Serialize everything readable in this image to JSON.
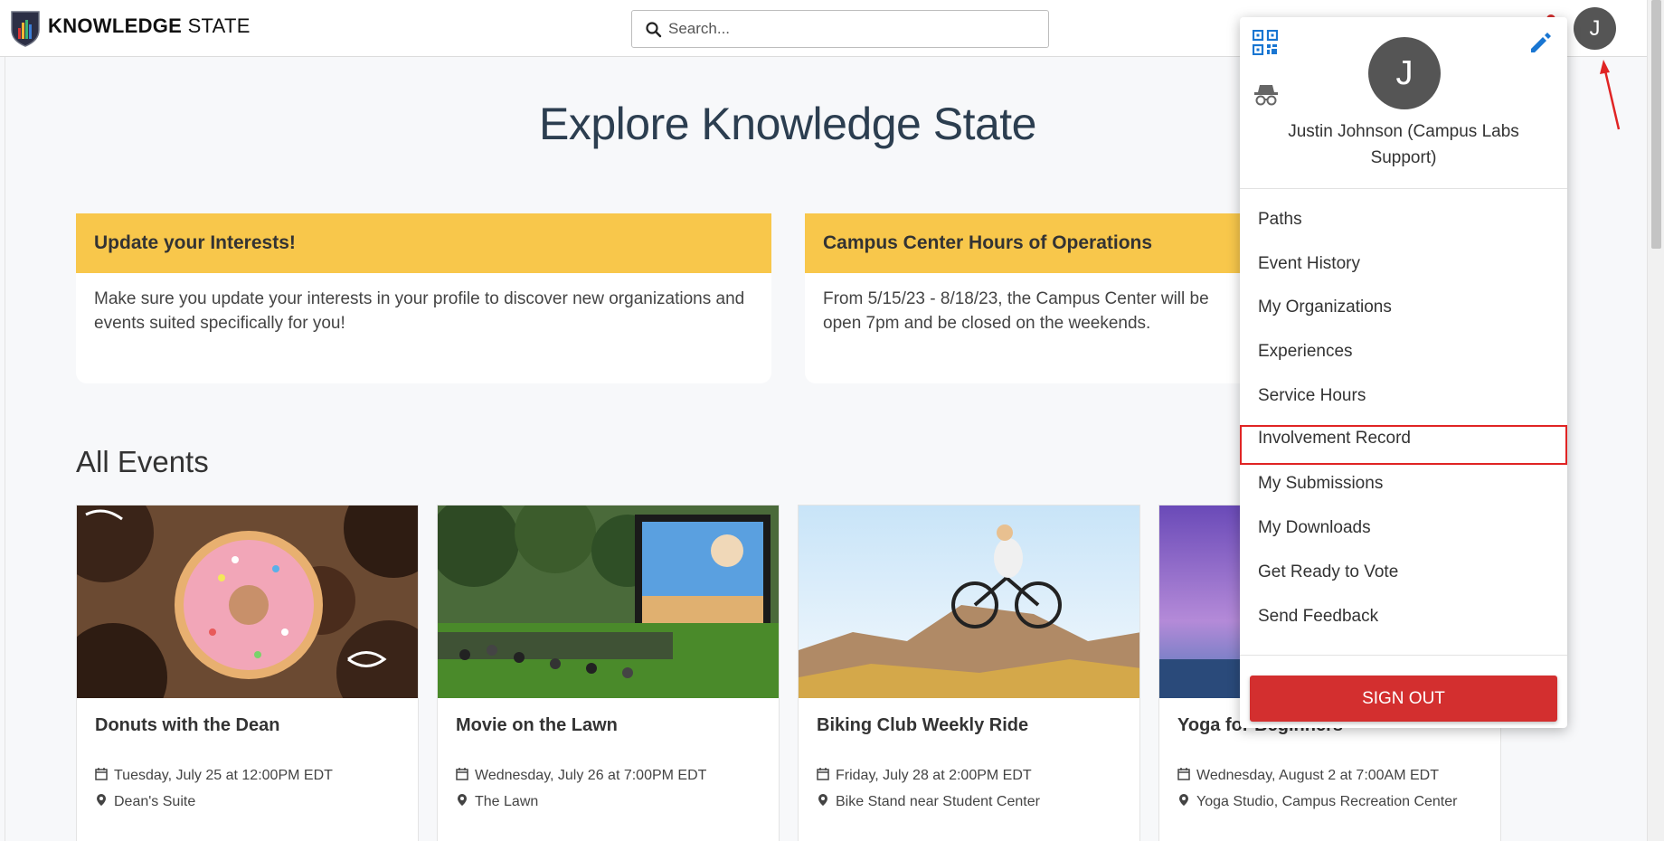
{
  "header": {
    "brand_bold": "KNOWLEDGE",
    "brand_light": "STATE",
    "search_placeholder": "Search...",
    "avatar_initial": "J"
  },
  "page": {
    "title": "Explore Knowledge State"
  },
  "announcements": [
    {
      "title": "Update your Interests!",
      "body": "Make sure you update your interests in your profile to discover new organizations and events suited specifically for you!"
    },
    {
      "title": "Campus Center Hours of Operations",
      "body": "From 5/15/23 - 8/18/23, the Campus Center will be open 7pm and be closed on the weekends."
    }
  ],
  "events_section": {
    "title": "All Events",
    "items": [
      {
        "title": "Donuts with the Dean",
        "date": "Tuesday, July 25 at 12:00PM EDT",
        "location": "Dean's Suite"
      },
      {
        "title": "Movie on the Lawn",
        "date": "Wednesday, July 26 at 7:00PM EDT",
        "location": "The Lawn"
      },
      {
        "title": "Biking Club Weekly Ride",
        "date": "Friday, July 28 at 2:00PM EDT",
        "location": "Bike Stand near Student Center"
      },
      {
        "title": "Yoga for Beginners",
        "date": "Wednesday, August 2 at 7:00AM EDT",
        "location": "Yoga Studio, Campus Recreation Center"
      }
    ]
  },
  "user_menu": {
    "avatar_initial": "J",
    "user_name": "Justin Johnson (Campus Labs Support)",
    "items": [
      {
        "label": "Paths"
      },
      {
        "label": "Event History"
      },
      {
        "label": "My Organizations"
      },
      {
        "label": "Experiences"
      },
      {
        "label": "Service Hours"
      },
      {
        "label": "Involvement Record",
        "highlighted": true
      },
      {
        "label": "My Submissions"
      },
      {
        "label": "My Downloads"
      },
      {
        "label": "Get Ready to Vote"
      },
      {
        "label": "Send Feedback"
      }
    ],
    "sign_out_label": "SIGN OUT"
  },
  "colors": {
    "accent_yellow": "#f8c74b",
    "sign_out_red": "#d32f2f",
    "edit_blue": "#1976d2",
    "highlight_red": "#e02424"
  }
}
